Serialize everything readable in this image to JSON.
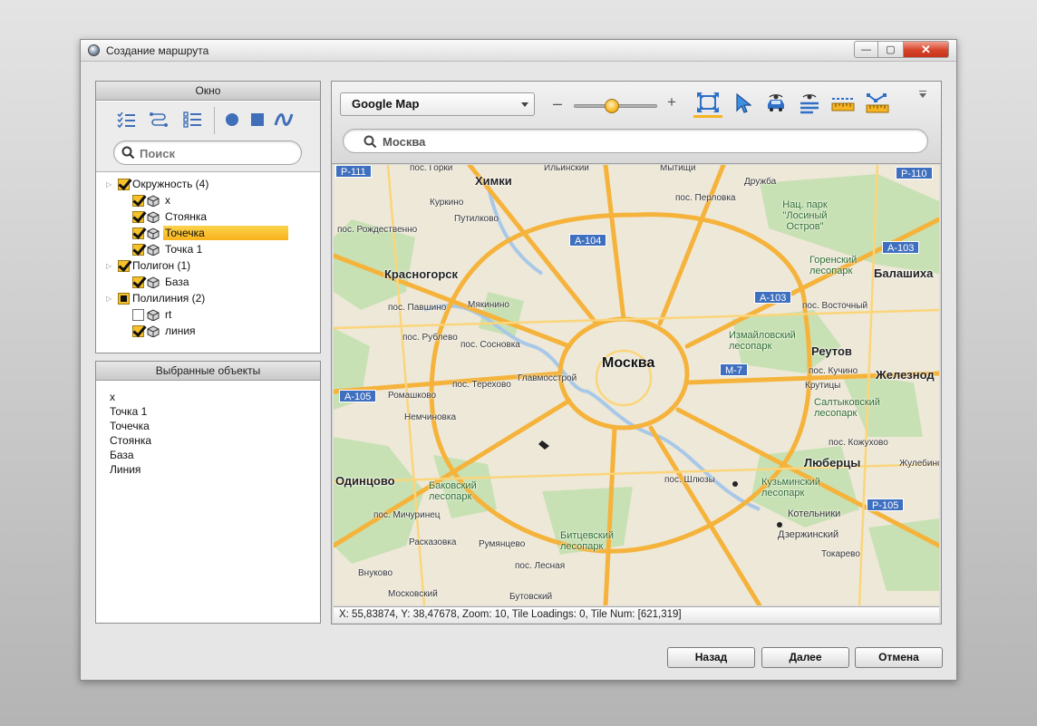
{
  "window": {
    "title": "Создание маршрута",
    "controls": {
      "minimize": "—",
      "maximize": "▢",
      "close": "✕"
    }
  },
  "left_panel": {
    "window_header": "Окно",
    "toolbar_icons": [
      "check-list-icon",
      "route-list-icon",
      "list-icon",
      "circle-icon",
      "square-icon",
      "curve-icon"
    ],
    "search": {
      "placeholder": "Поиск",
      "value": ""
    },
    "tree": [
      {
        "label": "Окружность (4)",
        "state": "checked",
        "expanded": true,
        "children": [
          {
            "label": "x",
            "state": "checked"
          },
          {
            "label": "Стоянка",
            "state": "checked"
          },
          {
            "label": "Точечка",
            "state": "checked",
            "selected": true
          },
          {
            "label": "Точка 1",
            "state": "checked"
          }
        ]
      },
      {
        "label": "Полигон (1)",
        "state": "checked",
        "expanded": true,
        "children": [
          {
            "label": "База",
            "state": "checked"
          }
        ]
      },
      {
        "label": "Полилиния (2)",
        "state": "partial",
        "expanded": true,
        "children": [
          {
            "label": "rt",
            "state": "unchecked"
          },
          {
            "label": "линия",
            "state": "checked"
          }
        ]
      }
    ],
    "selected_header": "Выбранные объекты",
    "selected_items": [
      "x",
      "Точка 1",
      "Точечка",
      "Стоянка",
      "База",
      "Линия"
    ]
  },
  "map_panel": {
    "map_source": "Google Map",
    "zoom_minus": "–",
    "zoom_plus": "+",
    "zoom_level_fraction": 0.45,
    "tools": [
      "fit-extent-icon",
      "pointer-icon",
      "car-view-icon",
      "route-view-icon",
      "ruler-icon",
      "path-edit-icon"
    ],
    "place_search": {
      "value": "Москва"
    },
    "map_labels": {
      "city": "Москва",
      "towns": [
        "Химки",
        "Красногорск",
        "Балашиха",
        "Реутов",
        "Железнод",
        "Люберцы",
        "Одинцово",
        "Дзержинский",
        "Котельники"
      ],
      "small": [
        "пос. Горки",
        "пос. Перловка",
        "Путилково",
        "пос. Рождественно",
        "пос. Павшино",
        "Мякинино",
        "пос. Сосновка",
        "пос. Рублево",
        "Главмосстрой",
        "пос. Терехово",
        "Ромашково",
        "Немчиновка",
        "пос. Восточный",
        "пос. Кучино",
        "Крутицы",
        "пос. Кожухово",
        "Жулебино",
        "пос. Шлюзы",
        "пос. Мичуринец",
        "Расказовка",
        "Румянцево",
        "Внуково",
        "Московский",
        "Бутовский",
        "Токарево",
        "Куркино",
        "Ильинский",
        "Мытищи",
        "Дружба",
        "пос. Лесная"
      ],
      "parks": [
        "Нац. парк \"Лосиный Остров\"",
        "Горенский лесопарк",
        "Измайловский лесопарк",
        "Салтыковский лесопарк",
        "Кузьминский лесопарк",
        "Баковский лесопарк",
        "Битцевский лесопарк"
      ],
      "shields": [
        "Р-111",
        "Р-110",
        "А-104",
        "А-103",
        "А-103",
        "М-7",
        "А-105",
        "Р-105"
      ]
    },
    "status": "X: 55,83874, Y: 38,47678, Zoom: 10, Tile Loadings: 0, Tile Num: [621,319]"
  },
  "buttons": {
    "back": "Назад",
    "next": "Далее",
    "cancel": "Отмена"
  },
  "colors": {
    "accent": "#f7b51f",
    "road": "#f5b33b",
    "shield": "#3f6fbf",
    "selection": "#fbc93a"
  }
}
